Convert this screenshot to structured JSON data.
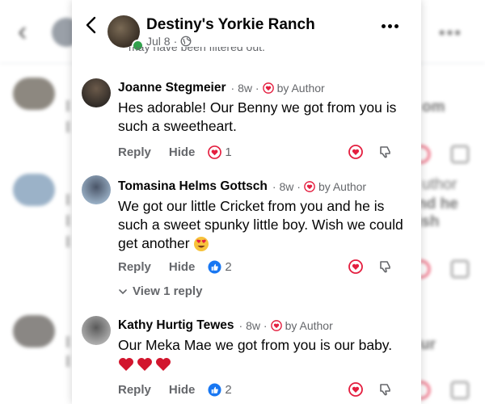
{
  "header": {
    "page_name": "Destiny's Yorkie Ranch",
    "date": "Jul 8",
    "separator": "·",
    "cut_off_text": "may have been filtered out."
  },
  "labels": {
    "reply": "Reply",
    "hide": "Hide",
    "by_author": "by Author",
    "view_replies": "View 1 reply"
  },
  "comments": [
    {
      "author": "Joanne Stegmeier",
      "time": "8w",
      "text": "Hes adorable! Our Benny we got from you is such a sweetheart.",
      "reaction_icon": "heart-reaction-icon",
      "reaction_count": "1"
    },
    {
      "author": "Tomasina Helms Gottsch",
      "time": "8w",
      "text": "We got our little Cricket from you and he is such a sweet spunky little boy. Wish we could get another",
      "emoji": "heart-eyes-emoji",
      "reaction_icon": "like-reaction-icon",
      "reaction_count": "2"
    },
    {
      "author": "Kathy Hurtig Tewes",
      "time": "8w",
      "text": "Our Meka Mae we got from you is our baby.",
      "emoji": "three-red-hearts-emoji",
      "reaction_icon": "like-reaction-icon",
      "reaction_count": "2"
    }
  ],
  "colors": {
    "author_heart": "#e41e3f",
    "like_blue": "#1877f2",
    "online_green": "#31a24c",
    "meta_gray": "#65676b"
  },
  "background_fragments": {
    "f1": "om",
    "f2": "uthor",
    "f3": "nd he",
    "f4": "ish",
    "f5": "ur"
  }
}
